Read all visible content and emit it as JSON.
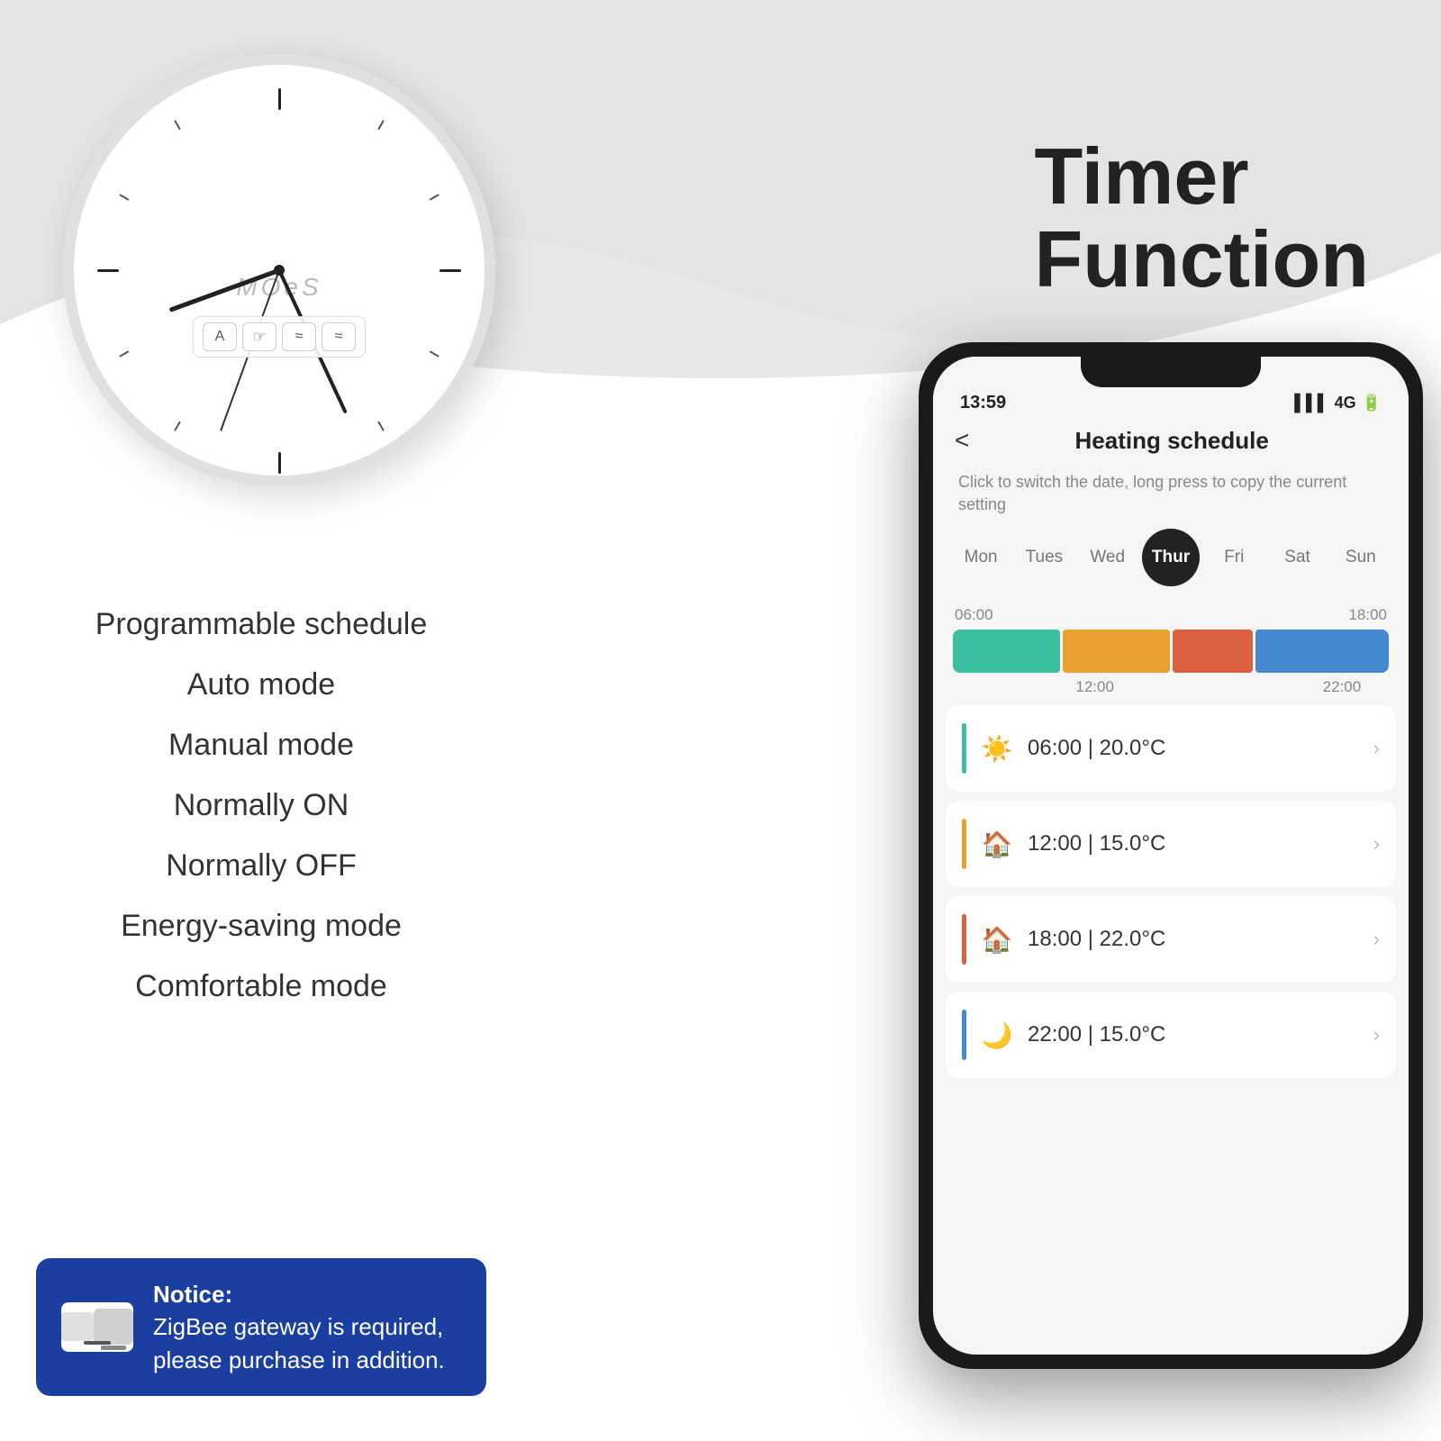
{
  "background": {
    "wave_color": "#e8e8e8",
    "base_color": "#f0f0f0"
  },
  "clock": {
    "brand": "MOeS",
    "buttons": [
      "A",
      "☞",
      "≈",
      "≈"
    ]
  },
  "timer_title": {
    "line1": "Timer",
    "line2": "Function"
  },
  "features": [
    "Programmable schedule",
    "Auto mode",
    "Manual mode",
    "Normally ON",
    "Normally OFF",
    "Energy-saving mode",
    "Comfortable mode"
  ],
  "notice": {
    "title": "Notice:",
    "body": "ZigBee gateway is required,\nplease purchase in addition."
  },
  "phone": {
    "status": {
      "time": "13:59",
      "signal": "4G",
      "battery": "●"
    },
    "header": {
      "back": "<",
      "title": "Heating schedule"
    },
    "instruction": "Click to switch the date, long press to copy the current setting",
    "days": [
      {
        "label": "Mon",
        "active": false
      },
      {
        "label": "Tues",
        "active": false
      },
      {
        "label": "Wed",
        "active": false
      },
      {
        "label": "Thur",
        "active": true
      },
      {
        "label": "Fri",
        "active": false
      },
      {
        "label": "Sat",
        "active": false
      },
      {
        "label": "Sun",
        "active": false
      }
    ],
    "timeline": {
      "start_label": "06:00",
      "mid_label": "18:00",
      "sub_label1": "12:00",
      "sub_label2": "22:00",
      "segments": [
        {
          "color": "#3bbfa0",
          "flex": 2
        },
        {
          "color": "#e8a030",
          "flex": 2
        },
        {
          "color": "#d96040",
          "flex": 1.5
        },
        {
          "color": "#4488d0",
          "flex": 2.5
        }
      ]
    },
    "schedule_items": [
      {
        "time": "06:00",
        "temp": "20.0°C",
        "color": "#3bbfa0",
        "icon": "☀"
      },
      {
        "time": "12:00",
        "temp": "15.0°C",
        "color": "#e8a030",
        "icon": "🏠"
      },
      {
        "time": "18:00",
        "temp": "22.0°C",
        "color": "#d96040",
        "icon": "🏠"
      },
      {
        "time": "22:00",
        "temp": "15.0°C",
        "color": "#4488d0",
        "icon": "🌙"
      }
    ]
  }
}
